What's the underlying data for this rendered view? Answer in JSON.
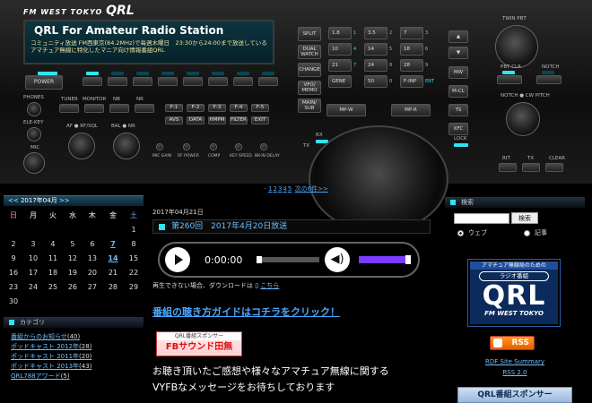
{
  "radio": {
    "brand_prefix": "FM WEST TOKYO",
    "brand_name": "QRL",
    "lcd_title": "QRL  For Amateur Radio Station",
    "lcd_line1": "コミュニティ放送 FM西東京(84.2MHz)で毎週木曜日　23:30から24:00まで放送している",
    "lcd_line2": "アマチュア無線に特化したマニア向け情報番組QRL",
    "power_label": "POWER",
    "labels": {
      "phones": "PHONES",
      "elekey": "ELE-KEY",
      "mic": "MIC",
      "tuner": "TUNER",
      "monitor": "MONITOR",
      "nb": "NB",
      "nr": "NR",
      "af": "AF",
      "rfsql": "RF/SQL",
      "bal": "BAL",
      "nr2": "NR",
      "micgain": "MIC GAIN",
      "rfpower": "RF POWER",
      "comp": "COMP",
      "keyspeed": "KEY SPEED",
      "bkin": "BK-IN DELAY",
      "tx": "TX",
      "rx": "RX",
      "lock": "LOCK",
      "twinpbt": "TWIN PBT",
      "pbtclr": "PBT CLR",
      "notch": "NOTCH",
      "notchcw": "NOTCH  ● CW PITCH",
      "rit": "RIT",
      "txl": "TX",
      "clear": "CLEAR"
    },
    "f_keys": [
      "F-1",
      "F-2",
      "F-3",
      "F-4",
      "F-5"
    ],
    "f_keys2": [
      "AVS",
      "DATA",
      "HMPM",
      "FILTER",
      "EXIT"
    ],
    "left_col_buttons": [
      "SPLIT",
      "DUAL\nWATCH",
      "CHANGE",
      "VFO/\nMEMO",
      "MAIN/\nSUB"
    ],
    "keypad": [
      [
        "1.8",
        "3.5",
        "7",
        "ENT"
      ],
      [
        "10",
        "14",
        "18"
      ],
      [
        "21",
        "24",
        "28"
      ],
      [
        "GENE",
        "50",
        "F-INP"
      ]
    ],
    "keypad_tail": [
      "1",
      "2",
      "3",
      "4",
      "5",
      "6",
      "7",
      "8",
      "9",
      "0",
      "ENT"
    ],
    "right_col_buttons": [
      "MW",
      "M-CL",
      "TS",
      "XFC"
    ],
    "mpw": "MP-W",
    "mpr": "MP-R"
  },
  "pager": {
    "prefix": "- ",
    "pages": [
      "1",
      "2",
      "3",
      "4",
      "5"
    ],
    "next": "次の6件>>"
  },
  "calendar": {
    "prev": "<<",
    "month": "2017年04月",
    "next": ">>",
    "weekdays": [
      "日",
      "月",
      "火",
      "水",
      "木",
      "金",
      "土"
    ],
    "rows": [
      [
        "",
        "",
        "",
        "",
        "",
        "",
        "1"
      ],
      [
        "2",
        "3",
        "4",
        "5",
        "6",
        "7",
        "8"
      ],
      [
        "9",
        "10",
        "11",
        "12",
        "13",
        "14",
        "15"
      ],
      [
        "16",
        "17",
        "18",
        "19",
        "20",
        "21",
        "22"
      ],
      [
        "23",
        "24",
        "25",
        "26",
        "27",
        "28",
        "29"
      ],
      [
        "30",
        "",
        "",
        "",
        "",
        "",
        ""
      ]
    ],
    "linked_days": [
      "7",
      "14"
    ]
  },
  "category": {
    "heading": "カテゴリ",
    "items": [
      {
        "label": "番組からのお知らせ",
        "count": "(40)"
      },
      {
        "label": "ポッドキャスト 2012年",
        "count": "(28)"
      },
      {
        "label": "ポッドキャスト 2011年",
        "count": "(20)"
      },
      {
        "label": "ポッドキャスト 2013年",
        "count": "(43)"
      },
      {
        "label": "QRL788アワード",
        "count": "(5)"
      }
    ]
  },
  "post": {
    "date": "2017年04月21日",
    "title": "第260回　2017年4月20日放送",
    "time": "0:00:00",
    "noplay_text": "再生できない場合、ダウンロードは",
    "noplay_link": "こちら",
    "guide": "番組の聴き方ガイドはコチラをクリック！",
    "sponsor_small": "QRL番組スポンサー",
    "sponsor_name": "FBサウンド田無",
    "message_line1": "お聴き頂いたご感想や様々なアマチュア無線に関する",
    "message_line2": "VYFBなメッセージをお待ちしております"
  },
  "search": {
    "heading": "検索",
    "button": "検索",
    "opt_web": "ウェブ",
    "opt_site": "記事"
  },
  "logo": {
    "line1": "アマチュア無線局のための",
    "line2": "ラジオ番組",
    "line3": "QRL",
    "line4": "FM WEST TOKYO"
  },
  "feeds": {
    "rss": "RSS",
    "rdf": "RDF Site Summary",
    "rss2": "RSS 2.0",
    "sponsor_heading": "QRL番組スポンサー"
  },
  "colors": {
    "accent": "#2ee6ef",
    "link": "#6fbfff",
    "sponsor_red": "#dd1111"
  }
}
